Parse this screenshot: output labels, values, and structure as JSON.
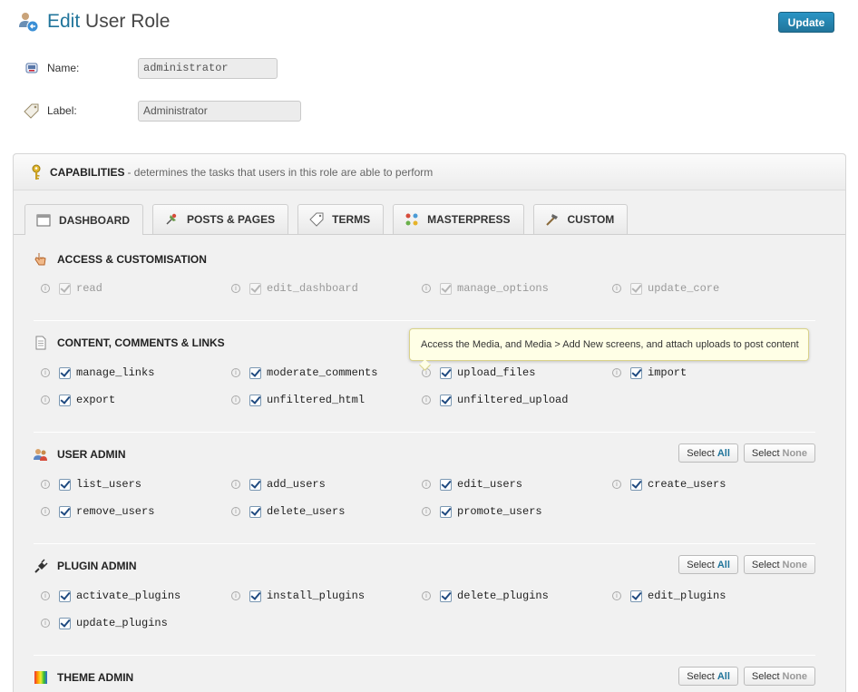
{
  "header": {
    "title_accent": "Edit",
    "title_rest": "User Role",
    "update_label": "Update"
  },
  "form": {
    "name_label": "Name:",
    "name_value": "administrator",
    "label_label": "Label:",
    "label_value": "Administrator"
  },
  "capabilities": {
    "title": "CAPABILITIES",
    "description": "- determines the tasks that users in this role are able to perform"
  },
  "tabs": [
    {
      "label": "DASHBOARD",
      "icon": "window-icon",
      "active": true
    },
    {
      "label": "POSTS & PAGES",
      "icon": "pin-icon",
      "active": false
    },
    {
      "label": "TERMS",
      "icon": "tag-icon",
      "active": false
    },
    {
      "label": "MASTERPRESS",
      "icon": "dots-icon",
      "active": false
    },
    {
      "label": "CUSTOM",
      "icon": "hammer-icon",
      "active": false
    }
  ],
  "select_all_prefix": "Select",
  "select_all_word": "All",
  "select_none_prefix": "Select",
  "select_none_word": "None",
  "sections": [
    {
      "title": "ACCESS & CUSTOMISATION",
      "icon": "hand-icon",
      "caps": [
        "read",
        "edit_dashboard",
        "manage_options",
        "update_core"
      ]
    },
    {
      "title": "CONTENT, COMMENTS & LINKS",
      "icon": "document-icon",
      "caps": [
        "manage_links",
        "moderate_comments",
        "upload_files",
        "import",
        "export",
        "unfiltered_html",
        "unfiltered_upload"
      ]
    },
    {
      "title": "USER ADMIN",
      "icon": "users-icon",
      "caps": [
        "list_users",
        "add_users",
        "edit_users",
        "create_users",
        "remove_users",
        "delete_users",
        "promote_users"
      ]
    },
    {
      "title": "PLUGIN ADMIN",
      "icon": "plug-icon",
      "caps": [
        "activate_plugins",
        "install_plugins",
        "delete_plugins",
        "edit_plugins",
        "update_plugins"
      ]
    },
    {
      "title": "THEME ADMIN",
      "icon": "palette-icon",
      "caps": []
    }
  ],
  "tooltip": "Access the Media, and Media > Add New screens, and attach uploads to post content",
  "colors": {
    "accent": "#21759b",
    "button_gradient_top": "#2a95c5",
    "tooltip_bg": "#ffffe6"
  }
}
